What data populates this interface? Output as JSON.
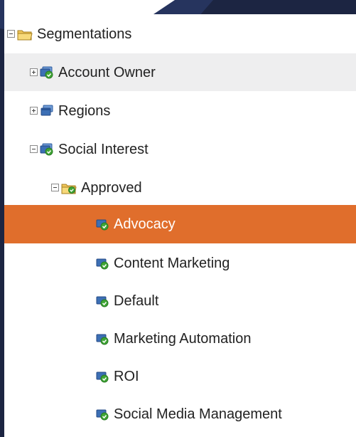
{
  "tree": {
    "root": {
      "label": "Segmentations",
      "icon": "folder-icon",
      "expanded": true
    },
    "segmentations": [
      {
        "label": "Account Owner",
        "icon": "segmentation-approved-icon",
        "expanded": false,
        "state": "hover"
      },
      {
        "label": "Regions",
        "icon": "segmentation-draft-icon",
        "expanded": false
      },
      {
        "label": "Social Interest",
        "icon": "segmentation-approved-icon",
        "expanded": true
      }
    ],
    "approved_folder": {
      "label": "Approved",
      "icon": "approved-folder-icon",
      "expanded": true
    },
    "segments": [
      {
        "label": "Advocacy",
        "icon": "segment-approved-icon",
        "selected": true
      },
      {
        "label": "Content Marketing",
        "icon": "segment-approved-icon"
      },
      {
        "label": "Default",
        "icon": "segment-approved-icon"
      },
      {
        "label": "Marketing Automation",
        "icon": "segment-approved-icon"
      },
      {
        "label": "ROI",
        "icon": "segment-approved-icon"
      },
      {
        "label": "Social Media Management",
        "icon": "segment-approved-icon"
      }
    ]
  },
  "colors": {
    "selected_background": "#e06e2c",
    "hover_background": "#eeeeef",
    "page_background": "#1c2542",
    "check_green": "#3fa535",
    "segment_blue": "#3c6fb5"
  }
}
